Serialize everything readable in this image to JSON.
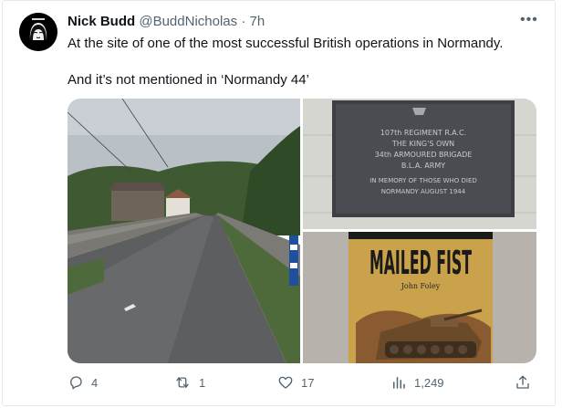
{
  "author": {
    "name": "Nick Budd",
    "handle": "@BuddNicholas",
    "separator": "·",
    "time": "7h"
  },
  "more_icon": "more-horizontal-icon",
  "tweet": {
    "line1": "At the site of one of the most successful British operations in Normandy.",
    "line2": "And it’s not mentioned in ‘Normandy 44’"
  },
  "media": {
    "plaque_text": [
      "107th REGIMENT R.A.C.",
      "THE KING'S OWN",
      "34th ARMOURED BRIGADE",
      "B.L.A. ARMY",
      "IN MEMORY OF THOSE WHO DIED",
      "NORMANDY AUGUST 1944"
    ],
    "book_title": "MAILED FIST",
    "book_author": "John Foley"
  },
  "actions": {
    "replies": "4",
    "reposts": "1",
    "likes": "17",
    "views": "1,249"
  },
  "colors": {
    "text": "#0f1419",
    "muted": "#536471",
    "border": "#e6e9ec"
  }
}
